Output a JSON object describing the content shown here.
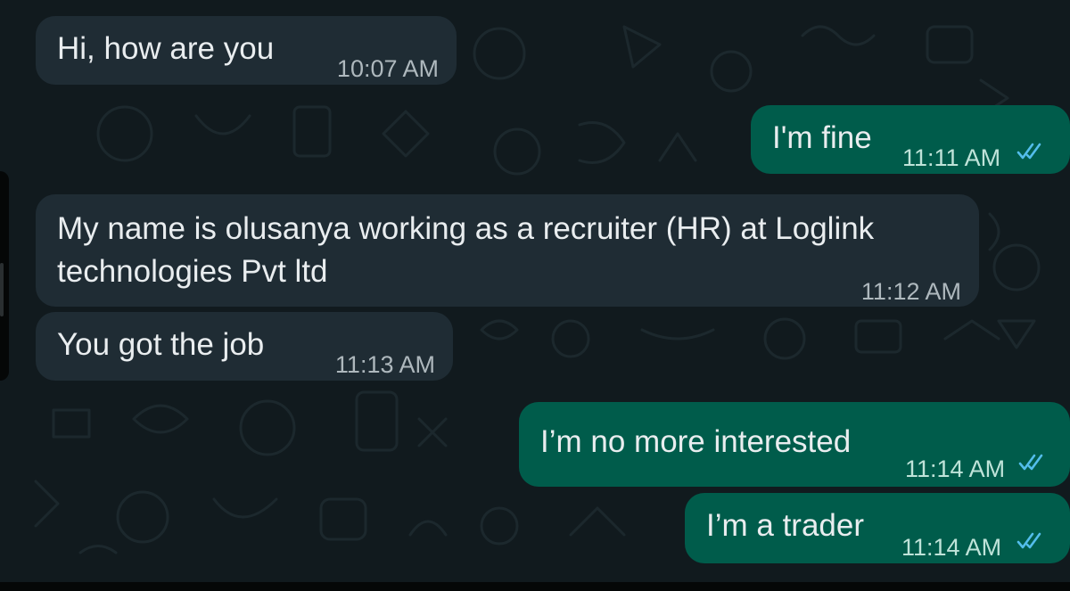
{
  "chat": {
    "messages": [
      {
        "direction": "incoming",
        "text": "Hi, how are you",
        "time": "10:07 AM"
      },
      {
        "direction": "outgoing",
        "text": "I'm fine",
        "time": "11:11 AM",
        "status": "read"
      },
      {
        "direction": "incoming",
        "text_lines": [
          "My name is olusanya working as a recruiter (HR) at Loglink",
          "technologies Pvt ltd"
        ],
        "time": "11:12 AM"
      },
      {
        "direction": "incoming",
        "text": "You got the job",
        "time": "11:13 AM"
      },
      {
        "direction": "outgoing",
        "text": "I’m no more interested",
        "time": "11:14 AM",
        "status": "read"
      },
      {
        "direction": "outgoing",
        "text": "I’m a trader",
        "time": "11:14 AM",
        "status": "read"
      }
    ]
  },
  "colors": {
    "background": "#111a1e",
    "incoming_bubble": "#1f2c34",
    "outgoing_bubble": "#005c4b",
    "read_ticks": "#53bdeb"
  },
  "icons": {
    "read_receipt": "double-check-icon"
  }
}
